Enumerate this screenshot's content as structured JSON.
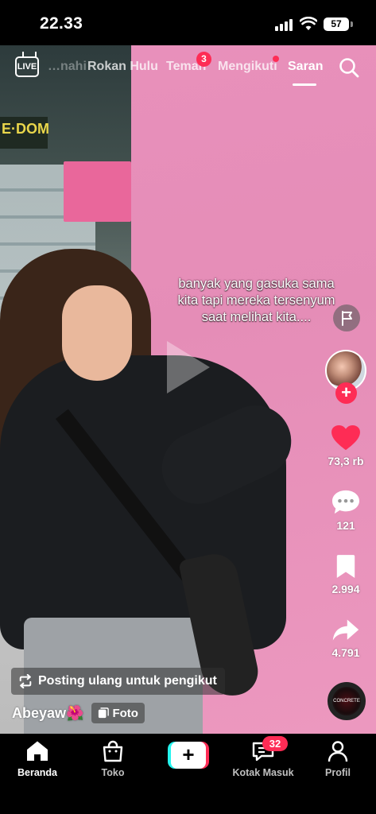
{
  "status_bar": {
    "time": "22.33",
    "battery": "57"
  },
  "top_nav": {
    "live_label": "LIVE",
    "tabs": [
      {
        "label": "…nahi",
        "state": "faded"
      },
      {
        "label": "Rokan Hulu",
        "state": "inactive"
      },
      {
        "label": "Teman",
        "state": "inactive",
        "badge": "3"
      },
      {
        "label": "Mengikuti",
        "state": "inactive",
        "dot": true
      },
      {
        "label": "Saran",
        "state": "active"
      }
    ],
    "search_icon": "search-icon"
  },
  "video": {
    "caption_lines": [
      "banyak yang gasuka sama",
      "kita tapi mereka tersenyum",
      "saat melihat kita...."
    ]
  },
  "right_rail": {
    "like_count": "73,3 rb",
    "comment_count": "121",
    "bookmark_count": "2.994",
    "share_count": "4.791",
    "music_disc_text": "CONCRETE"
  },
  "post": {
    "repost_label": "Posting ulang untuk pengikut",
    "author": "Abeyaw🌺",
    "type_label": "Foto"
  },
  "bottom_nav": {
    "items": [
      {
        "label": "Beranda",
        "icon": "home-icon",
        "active": true
      },
      {
        "label": "Toko",
        "icon": "shop-icon",
        "active": false
      },
      {
        "label": "",
        "icon": "create-icon",
        "active": false
      },
      {
        "label": "Kotak Masuk",
        "icon": "inbox-icon",
        "active": false,
        "badge": "32"
      },
      {
        "label": "Profil",
        "icon": "profile-icon",
        "active": false
      }
    ]
  },
  "colors": {
    "accent_red": "#fe2c55",
    "accent_cyan": "#25f4ee",
    "background": "#000000"
  }
}
